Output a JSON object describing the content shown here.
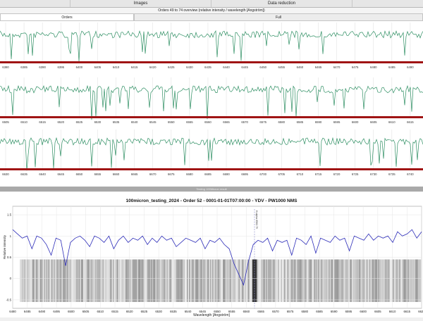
{
  "tabs": [
    {
      "label": "",
      "active": false
    },
    {
      "label": "Images",
      "active": false
    },
    {
      "label": "Data reduction",
      "active": false
    }
  ],
  "overview": {
    "title": "Orders 49 to 74 overview (relative intensity / wavelength [Angström])",
    "subtabs": [
      "Orders",
      "Full"
    ]
  },
  "rows": [
    {
      "ticks": [
        "6380",
        "6385",
        "6390",
        "6395",
        "6400",
        "6405",
        "6410",
        "6415",
        "6420",
        "6425",
        "6430",
        "6435",
        "6440",
        "6445",
        "6450",
        "6455",
        "6460",
        "6465",
        "6470",
        "6475",
        "6480",
        "6485",
        "6490"
      ]
    },
    {
      "ticks": [
        "6505",
        "6510",
        "6515",
        "6520",
        "6525",
        "6530",
        "6535",
        "6540",
        "6545",
        "6550",
        "6555",
        "6560",
        "6565",
        "6570",
        "6575",
        "6580",
        "6585",
        "6590",
        "6595",
        "6600",
        "6605",
        "6610",
        "6615"
      ]
    },
    {
      "ticks": [
        "6630",
        "6635",
        "6640",
        "6645",
        "6650",
        "6655",
        "6660",
        "6665",
        "6670",
        "6675",
        "6680",
        "6685",
        "6690",
        "6695",
        "6700",
        "6705",
        "6710",
        "6715",
        "6720",
        "6725",
        "6730",
        "6735",
        "6740"
      ]
    }
  ],
  "divider_label": "Testing 100Micron result",
  "chart_data": {
    "type": "line",
    "title": "100micron_testing_2024 - Order 52 - 0001-01-01T07:00:00 - YDV - PW1000 NMS",
    "xlabel": "Wavelength [Angström]",
    "ylabel": "Relative intensity",
    "x_ticks": [
      "6480",
      "6485",
      "6490",
      "6495",
      "6500",
      "6505",
      "6510",
      "6515",
      "6520",
      "6525",
      "6530",
      "6535",
      "6540",
      "6545",
      "6550",
      "6555",
      "6560",
      "6565",
      "6570",
      "6575",
      "6580",
      "6585",
      "6590",
      "6595",
      "6600",
      "6605",
      "6610",
      "6615",
      "6620"
    ],
    "y_ticks": [
      "1.5",
      "1",
      "0.5",
      "0",
      "-0.5"
    ],
    "xlim": [
      6480,
      6620
    ],
    "ylim": [
      -0.7,
      1.7
    ],
    "marker_label": "H-alpha 6562.79",
    "marker_x": 6562.79,
    "series": [
      {
        "color": "#2b2bb8",
        "values": [
          1.15,
          1.05,
          0.95,
          1.0,
          0.7,
          1.0,
          0.95,
          0.8,
          0.55,
          0.95,
          0.9,
          0.3,
          0.85,
          0.95,
          1.0,
          0.9,
          0.75,
          1.0,
          0.95,
          0.85,
          1.0,
          0.7,
          0.9,
          1.0,
          0.85,
          0.95,
          0.9,
          1.0,
          0.8,
          0.95,
          0.85,
          1.0,
          0.9,
          0.95,
          0.75,
          0.85,
          0.95,
          0.9,
          0.85,
          0.95,
          0.7,
          0.9,
          0.85,
          0.95,
          0.8,
          0.7,
          0.35,
          0.1,
          -0.15,
          0.4,
          0.8,
          0.9,
          0.85,
          0.95,
          0.65,
          0.9,
          0.85,
          0.9,
          0.55,
          0.95,
          0.9,
          0.8,
          1.0,
          0.6,
          0.95,
          0.9,
          0.85,
          1.0,
          0.9,
          0.95,
          0.65,
          1.0,
          0.95,
          0.9,
          1.05,
          0.9,
          1.0,
          0.95,
          1.0,
          0.85,
          1.1,
          1.0,
          1.05,
          1.15,
          0.95,
          1.1
        ]
      }
    ]
  }
}
